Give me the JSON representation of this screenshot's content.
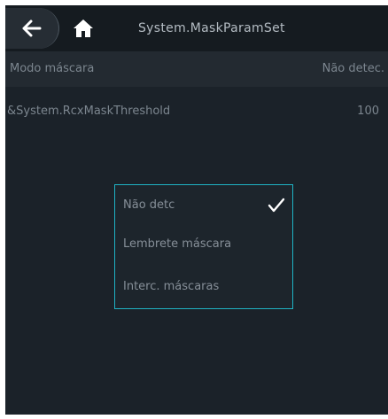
{
  "header": {
    "back_icon": "arrow-left-icon",
    "home_icon": "home-icon",
    "title": "System.MaskParamSet"
  },
  "rows": [
    {
      "label": "Modo máscara",
      "value": "Não detec."
    },
    {
      "label": "&System.RcxMaskThreshold",
      "value": "100"
    }
  ],
  "popup": {
    "options": [
      {
        "label": "Não detc",
        "selected": true
      },
      {
        "label": "Lembrete máscara",
        "selected": false
      },
      {
        "label": "Interc. máscaras",
        "selected": false
      }
    ],
    "check_icon": "checkmark-icon",
    "border_color": "#1fb3c4"
  }
}
